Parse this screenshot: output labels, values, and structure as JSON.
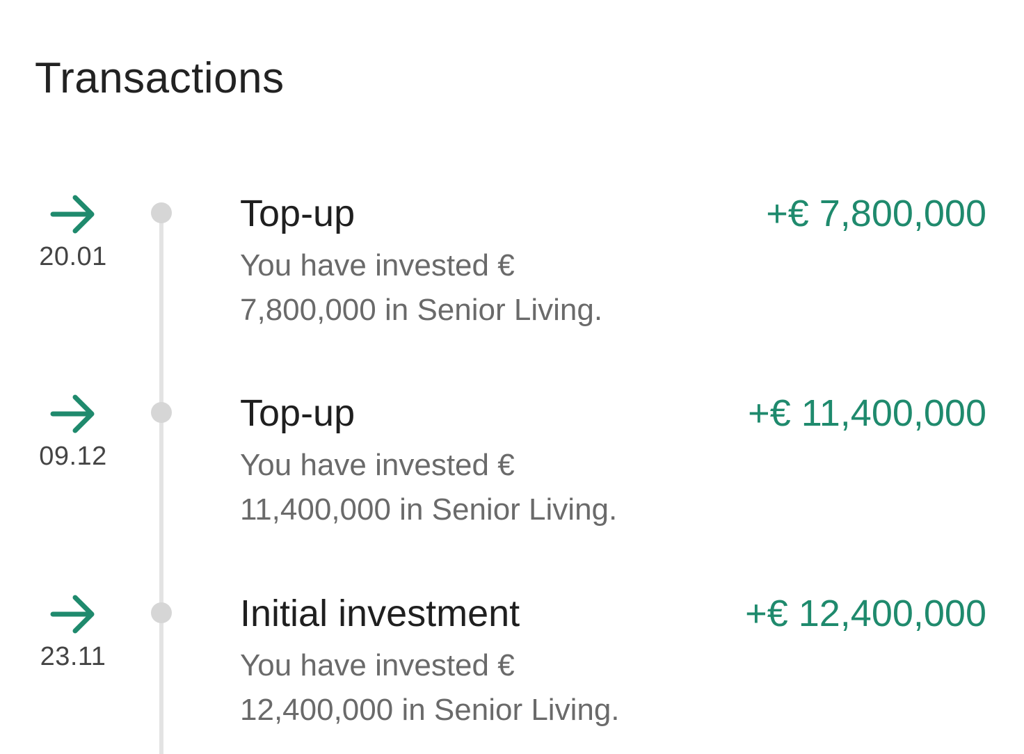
{
  "header": {
    "title": "Transactions"
  },
  "colors": {
    "accent": "#1f8a6d",
    "timeline": "#e3e3e3",
    "dot": "#d6d6d6",
    "text": "#1f1f1f",
    "muted": "#6a6a6a"
  },
  "transactions": [
    {
      "icon": "arrow-right-icon",
      "date": "20.01",
      "name": "Top-up",
      "amount": "+€ 7,800,000",
      "description_line1": "You have invested €",
      "description_line2": "7,800,000 in Senior Living."
    },
    {
      "icon": "arrow-right-icon",
      "date": "09.12",
      "name": "Top-up",
      "amount": "+€ 11,400,000",
      "description_line1": "You have invested €",
      "description_line2": "11,400,000 in Senior Living."
    },
    {
      "icon": "arrow-right-icon",
      "date": "23.11",
      "name": "Initial investment",
      "amount": "+€ 12,400,000",
      "description_line1": "You have invested €",
      "description_line2": "12,400,000 in Senior Living."
    }
  ]
}
